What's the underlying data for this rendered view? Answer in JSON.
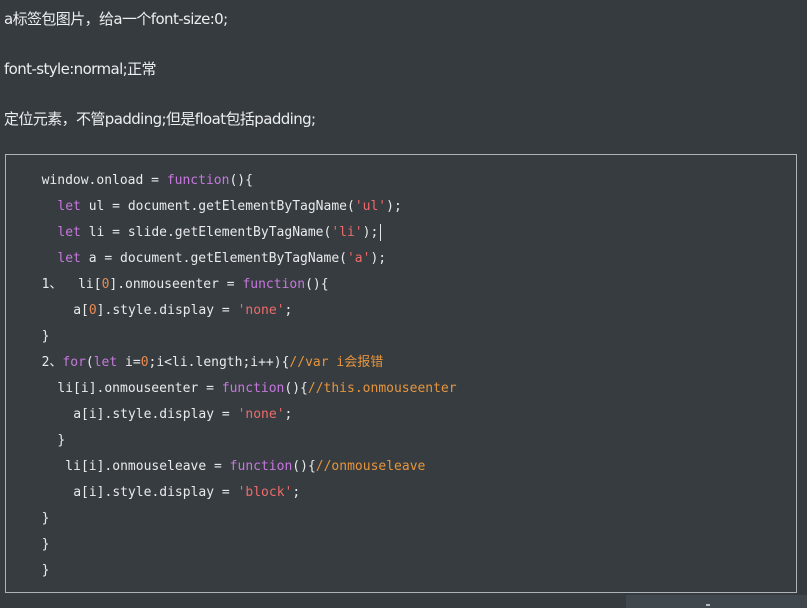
{
  "notes": [
    "a标签包图片，给a一个font-size:0;",
    "font-style:normal;正常",
    "定位元素，不管padding;但是float包括padding;"
  ],
  "code": {
    "lines": [
      {
        "indent": 4,
        "tokens": [
          {
            "t": "window.onload = "
          },
          {
            "t": "function",
            "k": "kw"
          },
          {
            "t": "(){"
          }
        ]
      },
      {
        "indent": 6,
        "tokens": [
          {
            "t": "let",
            "k": "kw"
          },
          {
            "t": " ul = document.getElementByTagName("
          },
          {
            "t": "'ul'",
            "k": "str"
          },
          {
            "t": ");"
          }
        ]
      },
      {
        "indent": 6,
        "caret": true,
        "tokens": [
          {
            "t": "let",
            "k": "kw"
          },
          {
            "t": " li = slide.getElementByTagName("
          },
          {
            "t": "'li'",
            "k": "str"
          },
          {
            "t": ");"
          }
        ]
      },
      {
        "indent": 6,
        "tokens": [
          {
            "t": "let",
            "k": "kw"
          },
          {
            "t": " a = document.getElementByTagName("
          },
          {
            "t": "'a'",
            "k": "str"
          },
          {
            "t": ");"
          }
        ]
      },
      {
        "indent": 4,
        "tokens": [
          {
            "t": "1、  li["
          },
          {
            "t": "0",
            "k": "num"
          },
          {
            "t": "].onmouseenter = "
          },
          {
            "t": "function",
            "k": "kw"
          },
          {
            "t": "(){"
          }
        ]
      },
      {
        "indent": 8,
        "tokens": [
          {
            "t": "a["
          },
          {
            "t": "0",
            "k": "num"
          },
          {
            "t": "].style.display = "
          },
          {
            "t": "'none'",
            "k": "str"
          },
          {
            "t": ";"
          }
        ]
      },
      {
        "indent": 4,
        "tokens": [
          {
            "t": "}"
          }
        ]
      },
      {
        "indent": 4,
        "tokens": [
          {
            "t": "2、"
          },
          {
            "t": "for",
            "k": "kw"
          },
          {
            "t": "("
          },
          {
            "t": "let",
            "k": "kw"
          },
          {
            "t": " i="
          },
          {
            "t": "0",
            "k": "num"
          },
          {
            "t": ";i<li.length;i++){"
          },
          {
            "t": "//var i会报错",
            "k": "cm"
          }
        ]
      },
      {
        "indent": 6,
        "tokens": [
          {
            "t": "li[i].onmouseenter = "
          },
          {
            "t": "function",
            "k": "kw"
          },
          {
            "t": "(){"
          },
          {
            "t": "//this.onmouseenter",
            "k": "cm"
          }
        ]
      },
      {
        "indent": 8,
        "tokens": [
          {
            "t": "a[i].style.display = "
          },
          {
            "t": "'none'",
            "k": "str"
          },
          {
            "t": ";"
          }
        ]
      },
      {
        "indent": 6,
        "tokens": [
          {
            "t": "}"
          }
        ]
      },
      {
        "indent": 7,
        "tokens": [
          {
            "t": "li[i].onmouseleave = "
          },
          {
            "t": "function",
            "k": "kw"
          },
          {
            "t": "(){"
          },
          {
            "t": "//onmouseleave",
            "k": "cm"
          }
        ]
      },
      {
        "indent": 8,
        "tokens": [
          {
            "t": "a[i].style.display = "
          },
          {
            "t": "'block'",
            "k": "str"
          },
          {
            "t": ";"
          }
        ]
      },
      {
        "indent": 4,
        "tokens": [
          {
            "t": "}"
          }
        ]
      },
      {
        "indent": 4,
        "tokens": [
          {
            "t": "}"
          }
        ]
      },
      {
        "indent": 4,
        "tokens": [
          {
            "t": "}"
          }
        ]
      }
    ]
  },
  "colors": {
    "background": "#353b3f",
    "keyword": "#c678dd",
    "string": "#ee6b6b",
    "number": "#e98b52",
    "comment": "#e6953c"
  }
}
